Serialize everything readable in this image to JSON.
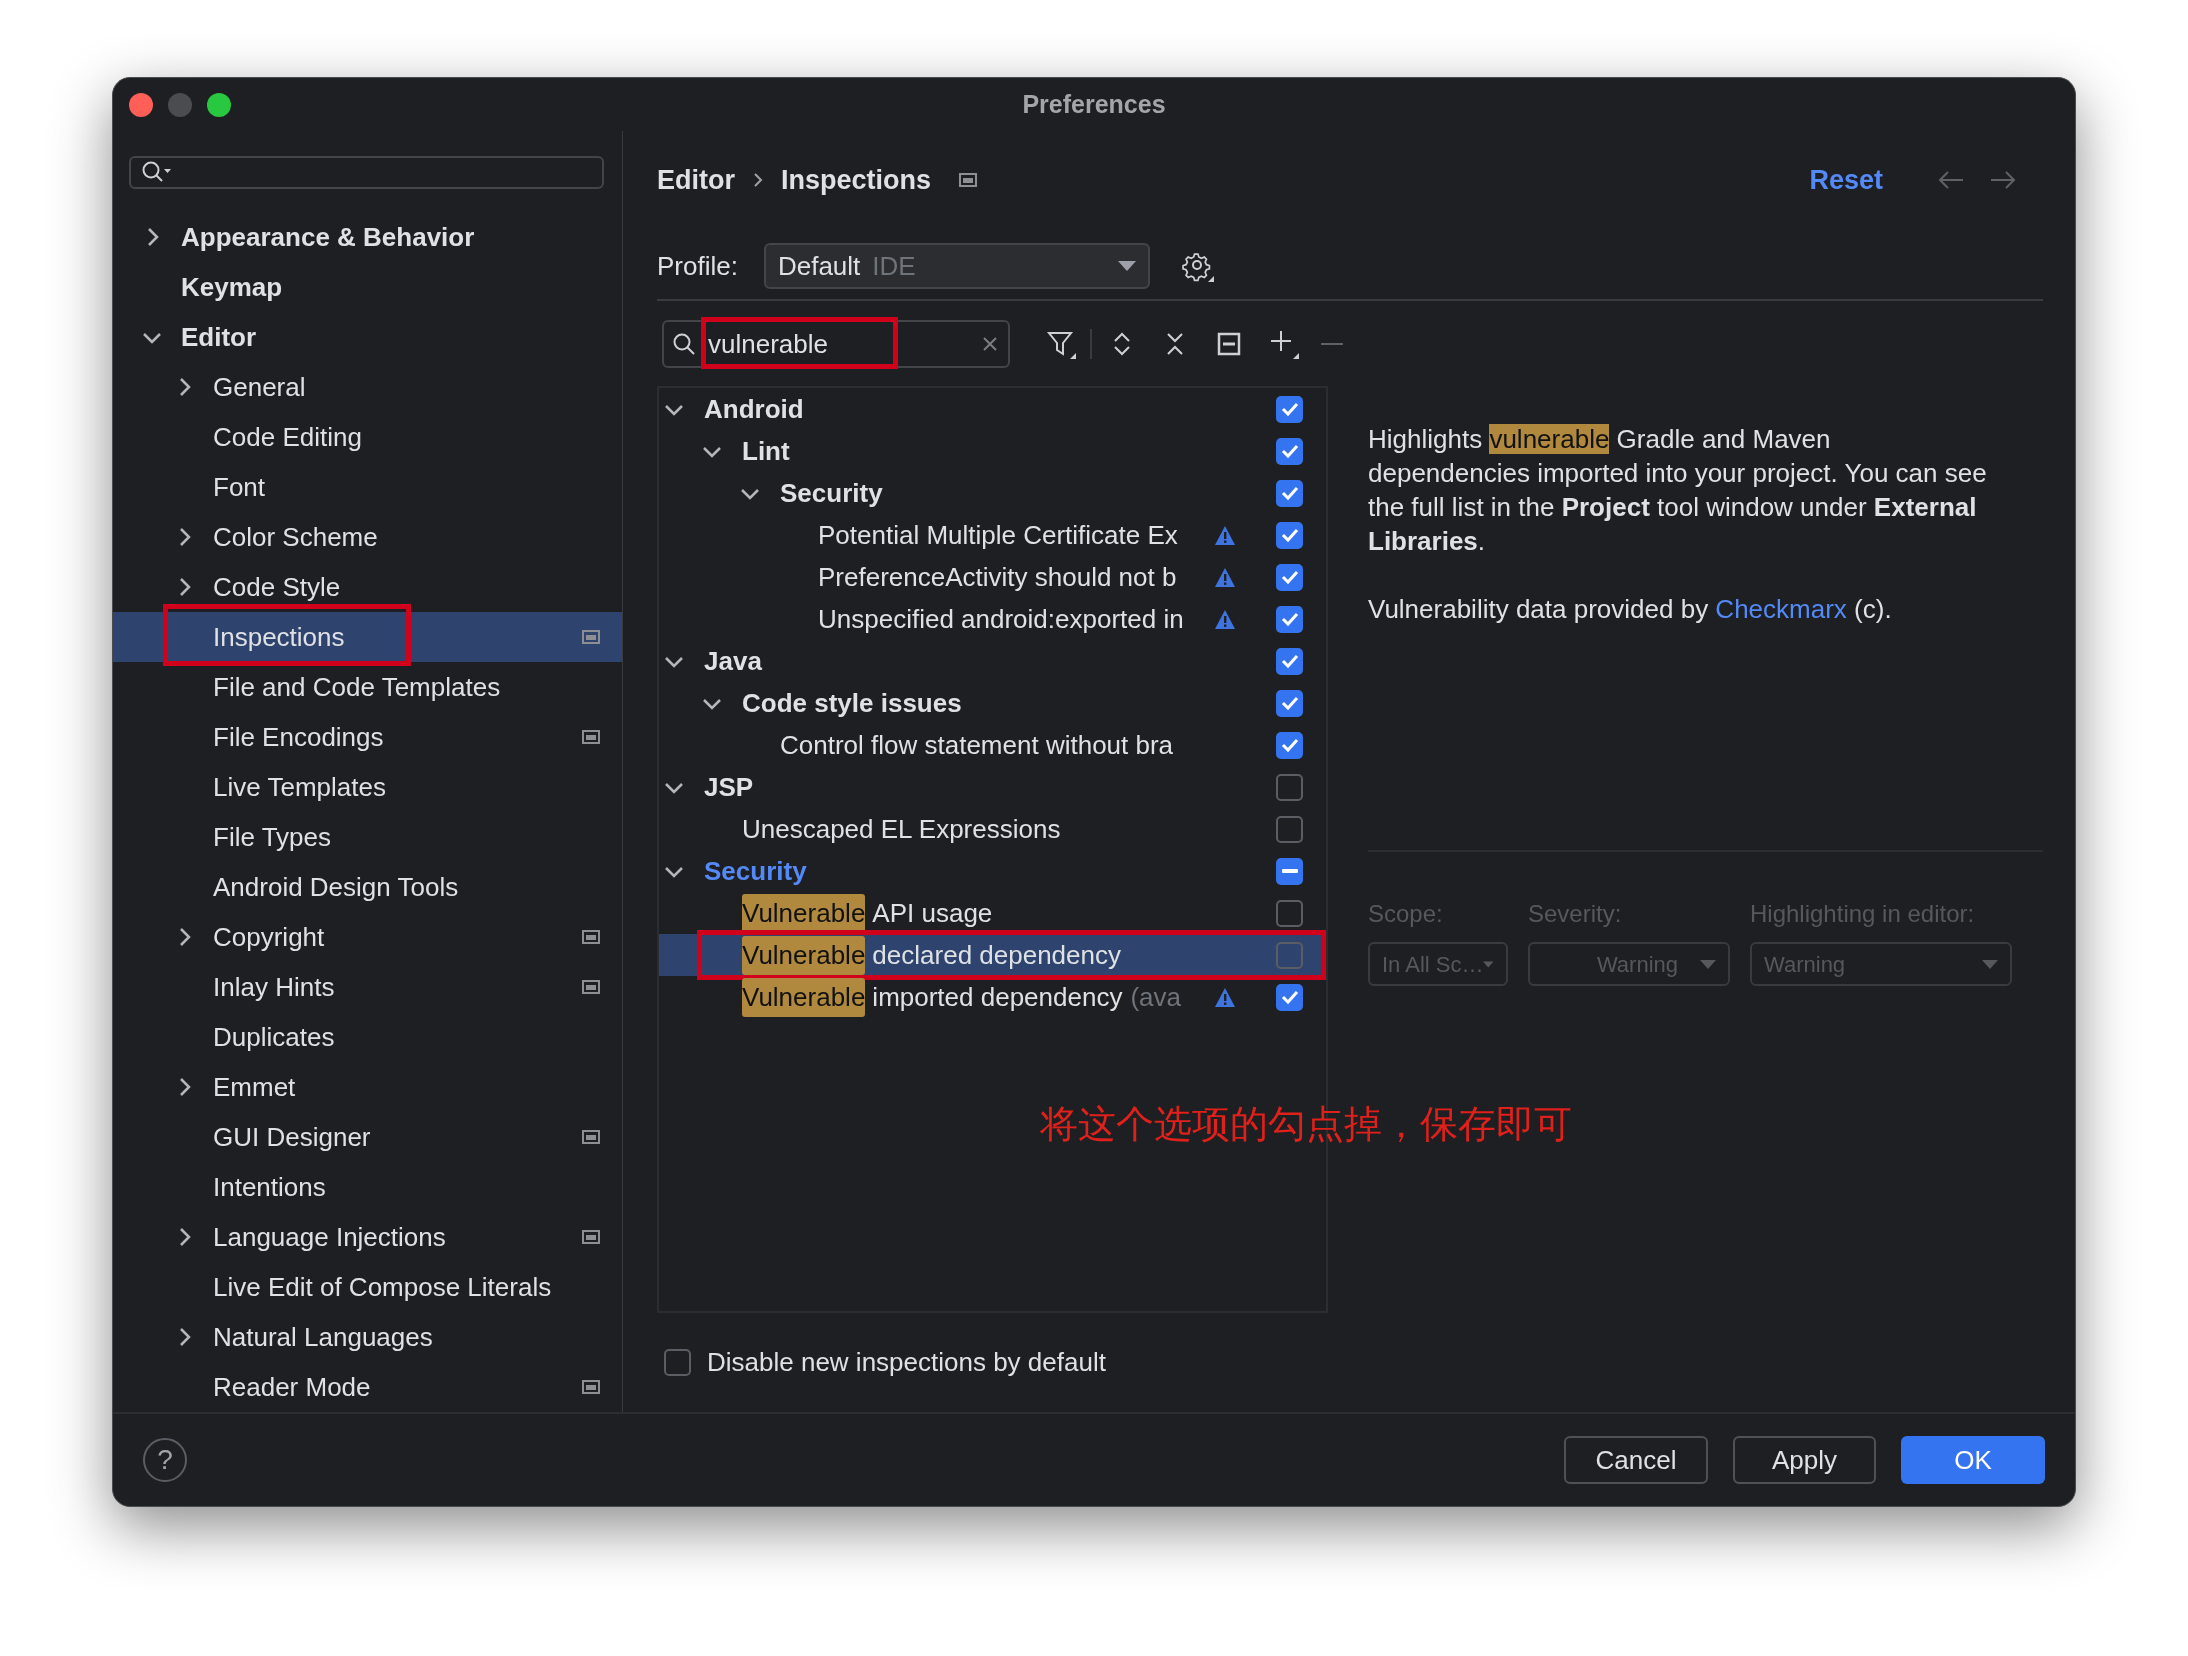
{
  "window": {
    "title": "Preferences"
  },
  "sidebar": {
    "items": [
      {
        "label": "Appearance & Behavior",
        "has_children": true,
        "expanded": false,
        "selected": false,
        "project_icon": false
      },
      {
        "label": "Keymap",
        "has_children": false,
        "selected": false,
        "project_icon": false
      },
      {
        "label": "Editor",
        "has_children": true,
        "expanded": true,
        "selected": false,
        "project_icon": false,
        "children": [
          {
            "label": "General",
            "has_children": true,
            "expanded": false,
            "selected": false,
            "project_icon": false
          },
          {
            "label": "Code Editing",
            "has_children": false,
            "selected": false,
            "project_icon": false
          },
          {
            "label": "Font",
            "has_children": false,
            "selected": false,
            "project_icon": false
          },
          {
            "label": "Color Scheme",
            "has_children": true,
            "expanded": false,
            "selected": false,
            "project_icon": false
          },
          {
            "label": "Code Style",
            "has_children": true,
            "expanded": false,
            "selected": false,
            "project_icon": false
          },
          {
            "label": "Inspections",
            "has_children": false,
            "selected": true,
            "project_icon": true
          },
          {
            "label": "File and Code Templates",
            "has_children": false,
            "selected": false,
            "project_icon": false
          },
          {
            "label": "File Encodings",
            "has_children": false,
            "selected": false,
            "project_icon": true
          },
          {
            "label": "Live Templates",
            "has_children": false,
            "selected": false,
            "project_icon": false
          },
          {
            "label": "File Types",
            "has_children": false,
            "selected": false,
            "project_icon": false
          },
          {
            "label": "Android Design Tools",
            "has_children": false,
            "selected": false,
            "project_icon": false
          },
          {
            "label": "Copyright",
            "has_children": true,
            "expanded": false,
            "selected": false,
            "project_icon": true
          },
          {
            "label": "Inlay Hints",
            "has_children": false,
            "selected": false,
            "project_icon": true
          },
          {
            "label": "Duplicates",
            "has_children": false,
            "selected": false,
            "project_icon": false
          },
          {
            "label": "Emmet",
            "has_children": true,
            "expanded": false,
            "selected": false,
            "project_icon": false
          },
          {
            "label": "GUI Designer",
            "has_children": false,
            "selected": false,
            "project_icon": true
          },
          {
            "label": "Intentions",
            "has_children": false,
            "selected": false,
            "project_icon": false
          },
          {
            "label": "Language Injections",
            "has_children": true,
            "expanded": false,
            "selected": false,
            "project_icon": true
          },
          {
            "label": "Live Edit of Compose Literals",
            "has_children": false,
            "selected": false,
            "project_icon": false
          },
          {
            "label": "Natural Languages",
            "has_children": true,
            "expanded": false,
            "selected": false,
            "project_icon": false
          },
          {
            "label": "Reader Mode",
            "has_children": false,
            "selected": false,
            "project_icon": true
          }
        ]
      }
    ]
  },
  "breadcrumb": [
    "Editor",
    "Inspections"
  ],
  "reset_link": "Reset",
  "profile": {
    "label": "Profile:",
    "value": "Default",
    "scope": "IDE"
  },
  "search": {
    "value": "vulnerable"
  },
  "inspections": [
    {
      "label": "Android",
      "checked": true,
      "partial": false,
      "expanded": true,
      "modified": false,
      "selected": false,
      "children": [
        {
          "label": "Lint",
          "checked": true,
          "partial": false,
          "expanded": true,
          "modified": false,
          "selected": false,
          "children": [
            {
              "label": "Security",
              "checked": true,
              "partial": false,
              "expanded": true,
              "modified": false,
              "selected": false,
              "children": [
                {
                  "label": "Potential Multiple Certificate Ex",
                  "checked": true,
                  "partial": false,
                  "warning": true,
                  "selected": false
                },
                {
                  "label": "PreferenceActivity should not b",
                  "checked": true,
                  "partial": false,
                  "warning": true,
                  "selected": false
                },
                {
                  "label": "Unspecified android:exported in",
                  "checked": true,
                  "partial": false,
                  "warning": true,
                  "selected": false
                }
              ]
            }
          ]
        }
      ]
    },
    {
      "label": "Java",
      "checked": true,
      "partial": false,
      "expanded": true,
      "modified": false,
      "selected": false,
      "children": [
        {
          "label": "Code style issues",
          "checked": true,
          "partial": false,
          "expanded": true,
          "modified": false,
          "selected": false,
          "children": [
            {
              "label": "Control flow statement without bra",
              "checked": true,
              "partial": false,
              "warning": false,
              "selected": false
            }
          ]
        }
      ]
    },
    {
      "label": "JSP",
      "checked": false,
      "partial": false,
      "expanded": true,
      "modified": false,
      "selected": false,
      "children": [
        {
          "label": "Unescaped EL Expressions",
          "checked": false,
          "partial": false,
          "warning": false,
          "selected": false
        }
      ]
    },
    {
      "label": "Security",
      "partial": true,
      "expanded": true,
      "modified": true,
      "selected": false,
      "children": [
        {
          "match": "Vulnerable",
          "label": "API usage",
          "checked": false,
          "partial": false,
          "warning": false,
          "selected": false
        },
        {
          "match": "Vulnerable",
          "label": "declared dependency",
          "checked": false,
          "partial": false,
          "warning": false,
          "selected": true
        },
        {
          "match": "Vulnerable",
          "label": "imported dependency",
          "note": "(ava",
          "checked": true,
          "partial": false,
          "warning": true,
          "selected": false
        }
      ]
    }
  ],
  "description": [
    [
      {
        "kind": "plain",
        "text": "Highlights "
      },
      {
        "kind": "match",
        "text": "vulnerable"
      },
      {
        "kind": "plain",
        "text": " Gradle and Maven dependencies imported into your project. You can see the full list in the "
      },
      {
        "kind": "bold",
        "text": "Project"
      },
      {
        "kind": "plain",
        "text": " tool window under "
      },
      {
        "kind": "bold",
        "text": "External Libraries"
      },
      {
        "kind": "plain",
        "text": "."
      }
    ],
    [
      {
        "kind": "plain",
        "text": "Vulnerability data provided by "
      },
      {
        "kind": "link",
        "text": "Checkmarx"
      },
      {
        "kind": "plain",
        "text": " (c)."
      }
    ]
  ],
  "options": {
    "disabled": true,
    "fields": [
      {
        "label": "Scope:",
        "value": "In All Sc…"
      },
      {
        "label": "Severity:",
        "value": "Warning"
      },
      {
        "label": "Highlighting in editor:",
        "value": "Warning"
      }
    ]
  },
  "disable_new": {
    "label": "Disable new inspections by default",
    "checked": false
  },
  "annotation": {
    "text": "将这个选项的勾点掉，保存即可"
  },
  "help": "?",
  "buttons": [
    {
      "label": "Cancel",
      "primary": false
    },
    {
      "label": "Apply",
      "primary": false
    },
    {
      "label": "OK",
      "primary": true
    }
  ]
}
